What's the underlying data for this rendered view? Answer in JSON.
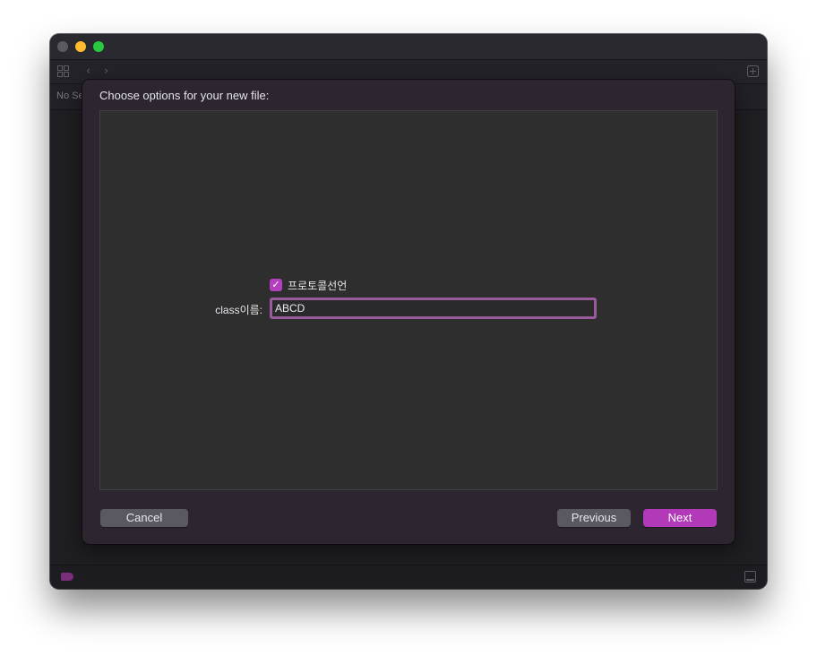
{
  "window": {
    "traffic_lights": [
      "close",
      "minimize",
      "zoom"
    ],
    "status_text": "No Se"
  },
  "toolbar": {
    "icons": [
      "grid-icon",
      "back-chevron-icon",
      "forward-chevron-icon",
      "add-editor-icon"
    ]
  },
  "sheet": {
    "title": "Choose options for your new file:",
    "checkbox": {
      "label": "프로토콜선언",
      "checked": true
    },
    "class_field": {
      "label": "class이름:",
      "value": "ABCD"
    },
    "buttons": {
      "cancel": "Cancel",
      "previous": "Previous",
      "next": "Next"
    }
  },
  "colors": {
    "accent": "#b23ab8",
    "focus_ring": "#9a5b9e",
    "checkbox": "#b43fbe"
  }
}
